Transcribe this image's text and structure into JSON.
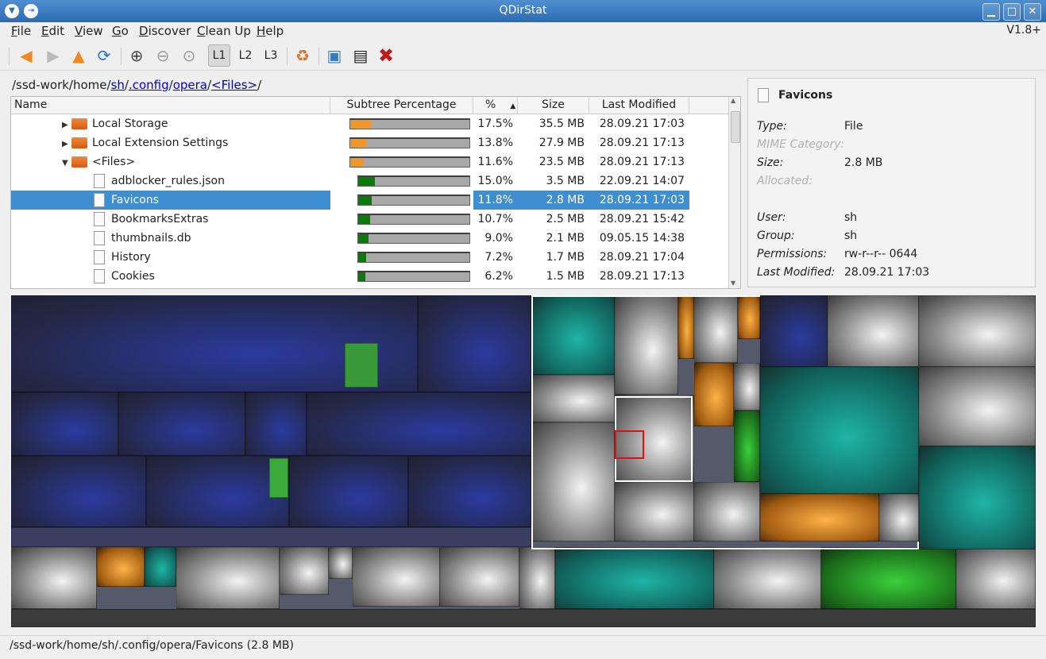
{
  "window": {
    "title": "QDirStat",
    "version": "V1.8+"
  },
  "menu": [
    "File",
    "Edit",
    "View",
    "Go",
    "Discover",
    "Clean Up",
    "Help"
  ],
  "toolbar": {
    "levels": [
      "L1",
      "L2",
      "L3"
    ]
  },
  "breadcrumb": {
    "prefix": "/ssd-work/home/",
    "parts": [
      "sh",
      ".config",
      "opera",
      "<Files>"
    ],
    "sep": "/"
  },
  "columns": {
    "name": "Name",
    "subtree": "Subtree Percentage",
    "percent": "%",
    "size": "Size",
    "modified": "Last Modified"
  },
  "rows": [
    {
      "name": "Local Storage",
      "kind": "folder",
      "expander": "▶",
      "indent": 1,
      "bar_pct": 17.5,
      "bar_color": "#f0962a",
      "percent": "17.5%",
      "size": "35.5 MB",
      "modified": "28.09.21 17:03"
    },
    {
      "name": "Local Extension Settings",
      "kind": "folder",
      "expander": "▶",
      "indent": 1,
      "bar_pct": 13.8,
      "bar_color": "#f0962a",
      "percent": "13.8%",
      "size": "27.9 MB",
      "modified": "28.09.21 17:13"
    },
    {
      "name": "<Files>",
      "kind": "folder",
      "expander": "▼",
      "indent": 1,
      "bar_pct": 11.6,
      "bar_color": "#f0962a",
      "percent": "11.6%",
      "size": "23.5 MB",
      "modified": "28.09.21 17:13"
    },
    {
      "name": "adblocker_rules.json",
      "kind": "file",
      "expander": "",
      "indent": 2,
      "bar_pct": 15.0,
      "bar_color": "#0a7a0a",
      "percent": "15.0%",
      "size": "3.5 MB",
      "modified": "22.09.21 14:07"
    },
    {
      "name": "Favicons",
      "kind": "file",
      "expander": "",
      "indent": 2,
      "bar_pct": 11.8,
      "bar_color": "#0a7a0a",
      "percent": "11.8%",
      "size": "2.8 MB",
      "modified": "28.09.21 17:03",
      "selected": true
    },
    {
      "name": "BookmarksExtras",
      "kind": "file",
      "expander": "",
      "indent": 2,
      "bar_pct": 10.7,
      "bar_color": "#0a7a0a",
      "percent": "10.7%",
      "size": "2.5 MB",
      "modified": "28.09.21 15:42"
    },
    {
      "name": "thumbnails.db",
      "kind": "file",
      "expander": "",
      "indent": 2,
      "bar_pct": 9.0,
      "bar_color": "#0a7a0a",
      "percent": "9.0%",
      "size": "2.1 MB",
      "modified": "09.05.15 14:38"
    },
    {
      "name": "History",
      "kind": "file",
      "expander": "",
      "indent": 2,
      "bar_pct": 7.2,
      "bar_color": "#0a7a0a",
      "percent": "7.2%",
      "size": "1.7 MB",
      "modified": "28.09.21 17:04"
    },
    {
      "name": "Cookies",
      "kind": "file",
      "expander": "",
      "indent": 2,
      "bar_pct": 6.2,
      "bar_color": "#0a7a0a",
      "percent": "6.2%",
      "size": "1.5 MB",
      "modified": "28.09.21 17:13"
    }
  ],
  "details": {
    "title": "Favicons",
    "fields": [
      {
        "key": "Type:",
        "value": "File",
        "dim": false
      },
      {
        "key": "MIME Category:",
        "value": "",
        "dim": true
      },
      {
        "key": "Size:",
        "value": "2.8 MB",
        "dim": false
      },
      {
        "key": "Allocated:",
        "value": "",
        "dim": true
      },
      {
        "key": "",
        "value": "",
        "dim": false
      },
      {
        "key": "User:",
        "value": "sh",
        "dim": false
      },
      {
        "key": "Group:",
        "value": "sh",
        "dim": false
      },
      {
        "key": "Permissions:",
        "value": "rw-r--r--  0644",
        "dim": false
      },
      {
        "key": "Last Modified:",
        "value": "28.09.21 17:03",
        "dim": false
      }
    ]
  },
  "status": "/ssd-work/home/sh/.config/opera/Favicons  (2.8 MB)",
  "colors": {
    "selection": "#3e8ed0",
    "folder_bar": "#f0962a",
    "file_bar": "#0a7a0a",
    "link": "#0000cc"
  }
}
